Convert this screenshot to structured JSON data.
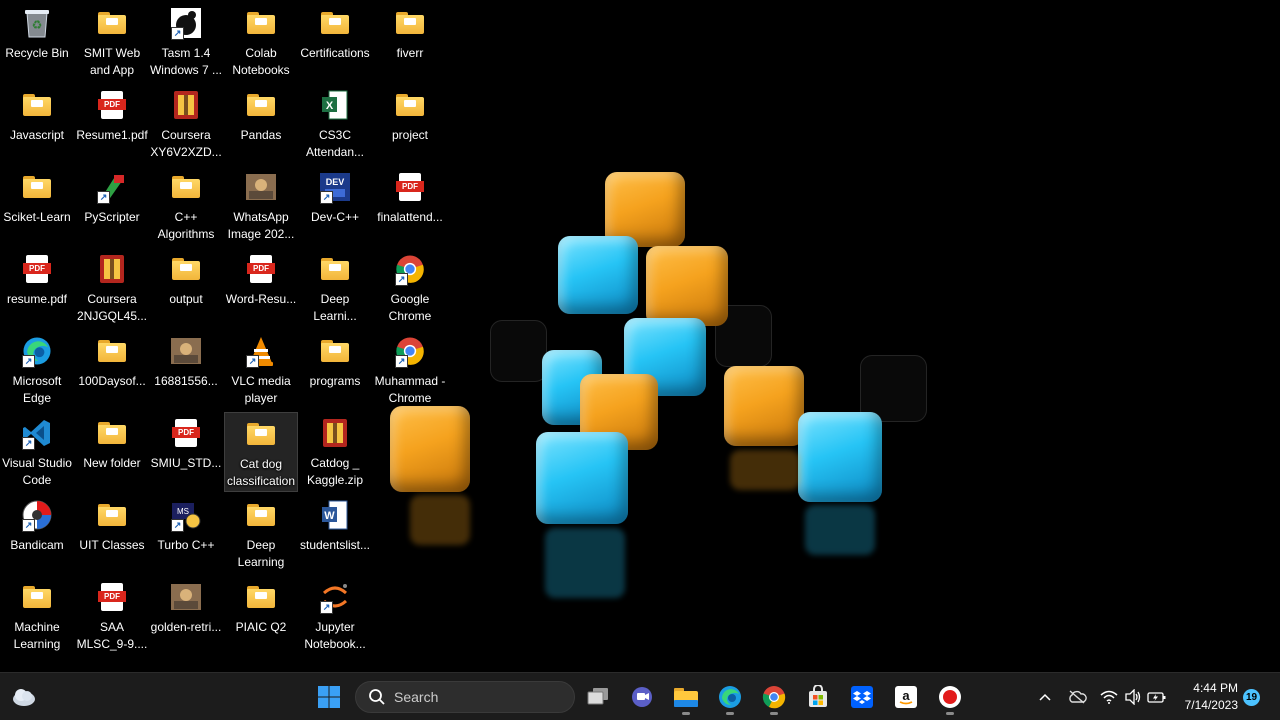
{
  "desktop": {
    "icons": [
      {
        "label": "Recycle Bin",
        "type": "recycle"
      },
      {
        "label": "Javascript",
        "type": "folder"
      },
      {
        "label": "Sciket-Learn",
        "type": "folder"
      },
      {
        "label": "resume.pdf",
        "type": "pdf"
      },
      {
        "label": "Microsoft Edge",
        "type": "edge"
      },
      {
        "label": "Visual Studio Code",
        "type": "vscode"
      },
      {
        "label": "Bandicam",
        "type": "bandicam"
      },
      {
        "label": "Machine Learning",
        "type": "folder"
      },
      {
        "label": "SMIT Web and App",
        "type": "folder"
      },
      {
        "label": "Resume1.pdf",
        "type": "pdf"
      },
      {
        "label": "PyScripter",
        "type": "pyscripter"
      },
      {
        "label": "Coursera 2NJGQL45...",
        "type": "archive"
      },
      {
        "label": "100Daysof...",
        "type": "folder"
      },
      {
        "label": "New folder",
        "type": "folder"
      },
      {
        "label": "UIT Classes",
        "type": "folder"
      },
      {
        "label": "SAA MLSC_9-9....",
        "type": "pdf"
      },
      {
        "label": "Tasm 1.4 Windows 7 ...",
        "type": "tasm"
      },
      {
        "label": "Coursera XY6V2XZD...",
        "type": "archive"
      },
      {
        "label": "C++ Algorithms",
        "type": "folder"
      },
      {
        "label": "output",
        "type": "folder"
      },
      {
        "label": "16881556...",
        "type": "image"
      },
      {
        "label": "SMIU_STD...",
        "type": "pdf"
      },
      {
        "label": "Turbo C++",
        "type": "turbo"
      },
      {
        "label": "golden-retri...",
        "type": "image"
      },
      {
        "label": "Colab Notebooks",
        "type": "folder"
      },
      {
        "label": "Pandas",
        "type": "folder"
      },
      {
        "label": "WhatsApp Image 202...",
        "type": "image"
      },
      {
        "label": "Word-Resu...",
        "type": "pdf"
      },
      {
        "label": "VLC media player",
        "type": "vlc"
      },
      {
        "label": "Cat dog classification",
        "type": "folder"
      },
      {
        "label": "Deep Learning",
        "type": "folder"
      },
      {
        "label": "PIAIC Q2",
        "type": "folder"
      },
      {
        "label": "Certifications",
        "type": "folder"
      },
      {
        "label": "CS3C Attendan...",
        "type": "excel"
      },
      {
        "label": "Dev-C++",
        "type": "devcpp"
      },
      {
        "label": "Deep Learni...",
        "type": "folder"
      },
      {
        "label": "programs",
        "type": "folder"
      },
      {
        "label": "Catdog _ Kaggle.zip",
        "type": "archive"
      },
      {
        "label": "studentslist...",
        "type": "word"
      },
      {
        "label": "Jupyter Notebook...",
        "type": "jupyter"
      },
      {
        "label": "fiverr",
        "type": "folder"
      },
      {
        "label": "project",
        "type": "folder"
      },
      {
        "label": "finalattend...",
        "type": "pdf"
      },
      {
        "label": "Google Chrome",
        "type": "chrome"
      },
      {
        "label": "Muhammad - Chrome",
        "type": "chrome"
      }
    ]
  },
  "taskbar": {
    "search_placeholder": "Search",
    "clock_time": "4:44 PM",
    "clock_date": "7/14/2023",
    "notification_count": "19"
  },
  "colors": {
    "taskbar_bg": "#1c1c1c",
    "accent": "#4cc2ff",
    "folder": "#f2b53a"
  }
}
